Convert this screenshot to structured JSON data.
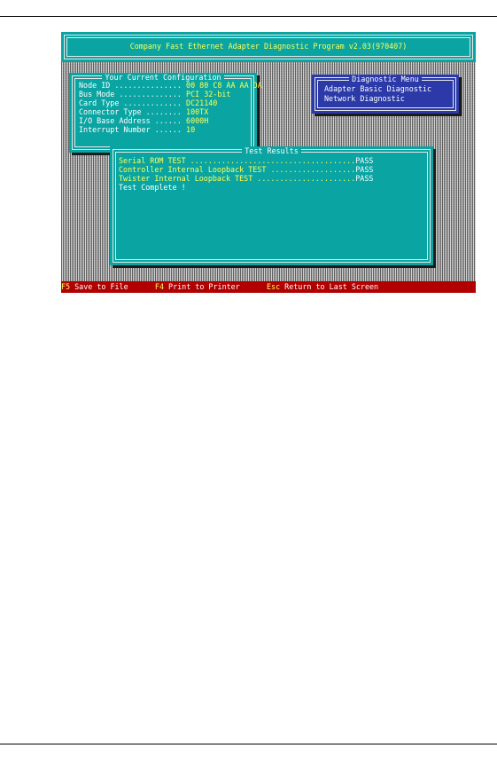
{
  "title": "Company Fast Ethernet Adapter Diagnostic Program v2.03(970407)",
  "config": {
    "title": "Your Current Configuration",
    "rows": [
      {
        "label": "Node ID ...............",
        "value": "00 80 C8 AA AA DA"
      },
      {
        "label": "Bus Mode ..............",
        "value": "PCI 32-bit"
      },
      {
        "label": "Card Type .............",
        "value": "DC21140"
      },
      {
        "label": "Connector Type ........",
        "value": "100TX"
      },
      {
        "label": "I/O Base Address ......",
        "value": "6000H"
      },
      {
        "label": "Interrupt Number ......",
        "value": "10"
      }
    ]
  },
  "diagnostic_menu": {
    "title": "Diagnostic Menu",
    "items": [
      "Adapter Basic Diagnostic",
      "Network Diagnostic"
    ]
  },
  "results": {
    "title": "Test Results",
    "tests": [
      {
        "name": "Serial ROM TEST",
        "dots": " .....................................",
        "status": "PASS"
      },
      {
        "name": "Controller Internal Loopback TEST",
        "dots": " ...................",
        "status": "PASS"
      },
      {
        "name": "Twister Internal Loopback TEST",
        "dots": " ......................",
        "status": "PASS"
      }
    ],
    "complete": "Test Complete !"
  },
  "function_keys": [
    {
      "key": "F5",
      "label": " Save to File"
    },
    {
      "key": "F4",
      "label": " Print to Printer"
    },
    {
      "key": "Esc",
      "label": " Return to Last Screen"
    }
  ],
  "colors": {
    "panel": "#0aa5a2",
    "menu": "#2b3aa8",
    "function_bar": "#b00000",
    "value_text": "#ffff55"
  }
}
